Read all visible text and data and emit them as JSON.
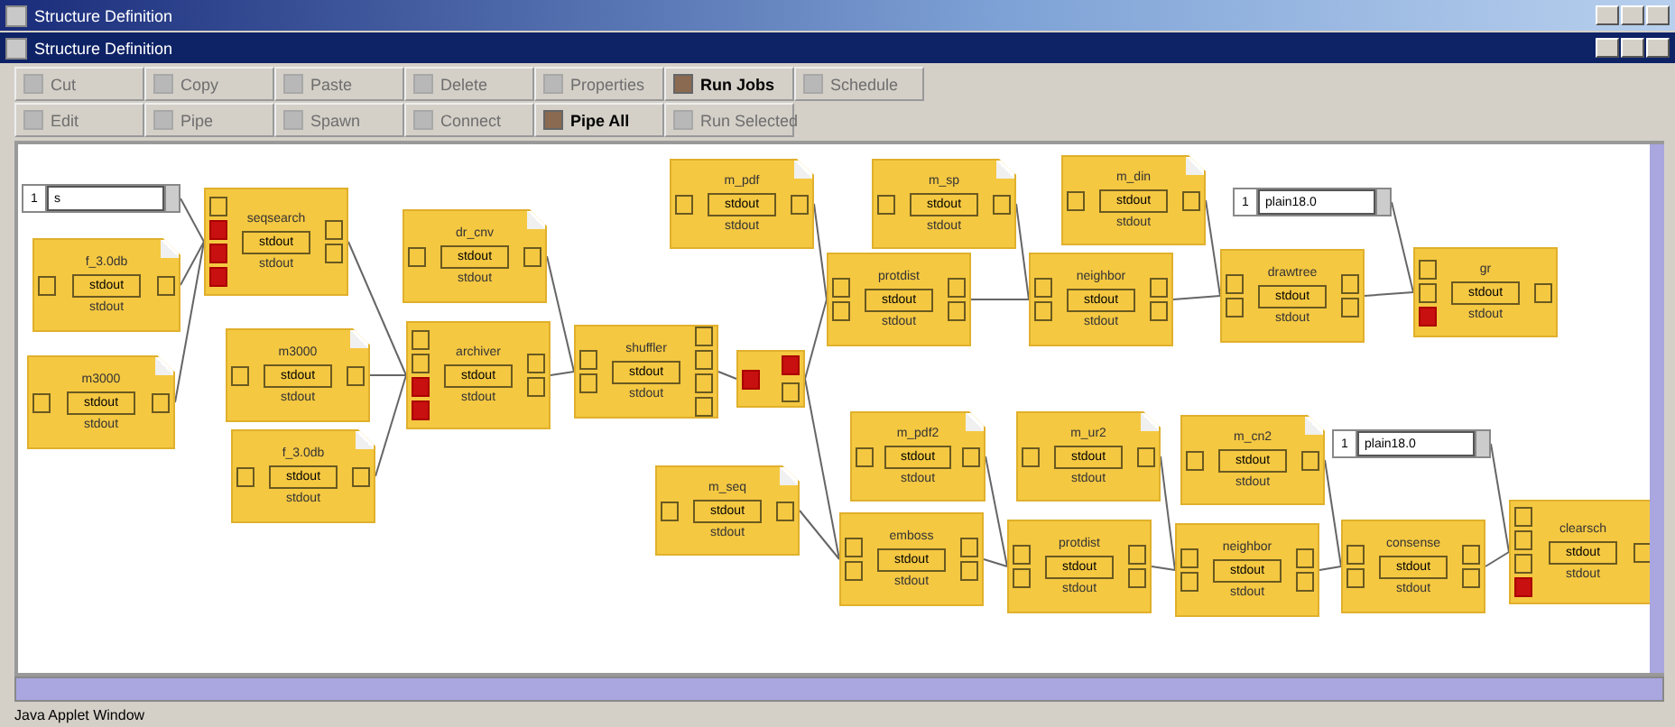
{
  "window": {
    "title": "Structure Definition"
  },
  "inner_window": {
    "title": "Structure Definition"
  },
  "toolbar": [
    [
      {
        "label": "Cut",
        "disabled": true
      },
      {
        "label": "Copy",
        "disabled": true
      },
      {
        "label": "Paste",
        "disabled": true
      },
      {
        "label": "Delete",
        "disabled": true
      },
      {
        "label": "Properties",
        "disabled": true
      },
      {
        "label": "Run Jobs",
        "disabled": false
      },
      {
        "label": "Schedule",
        "disabled": true
      }
    ],
    [
      {
        "label": "Edit",
        "disabled": true
      },
      {
        "label": "Pipe",
        "disabled": true
      },
      {
        "label": "Spawn",
        "disabled": true
      },
      {
        "label": "Connect",
        "disabled": true
      },
      {
        "label": "Pipe All",
        "disabled": false
      },
      {
        "label": "Run Selected",
        "disabled": true
      }
    ]
  ],
  "nodes": [
    {
      "kind": "input",
      "index": "1",
      "value": "s"
    },
    {
      "kind": "document",
      "name": "f_3.0db",
      "label": "stdout",
      "caption": "stdout"
    },
    {
      "kind": "document",
      "name": "m3000",
      "label": "stdout",
      "caption": "stdout"
    },
    {
      "kind": "process",
      "name": "seqsearch",
      "label": "stdout",
      "caption": "stdout",
      "in_ports": [
        {
          "filled": false
        },
        {
          "filled": true
        },
        {
          "filled": true
        },
        {
          "filled": true
        }
      ],
      "out_ports": [
        {
          "filled": false
        },
        {
          "filled": false
        }
      ]
    },
    {
      "kind": "document",
      "name": "dr_cnv",
      "label": "stdout",
      "caption": "stdout"
    },
    {
      "kind": "document",
      "name": "m3000",
      "label": "stdout",
      "caption": "stdout"
    },
    {
      "kind": "document",
      "name": "f_3.0db",
      "label": "stdout",
      "caption": "stdout"
    },
    {
      "kind": "process",
      "name": "archiver",
      "label": "stdout",
      "caption": "stdout",
      "in_ports": [
        {
          "filled": false
        },
        {
          "filled": false
        },
        {
          "filled": true
        },
        {
          "filled": true
        }
      ],
      "out_ports": [
        {
          "filled": false
        },
        {
          "filled": false
        }
      ]
    },
    {
      "kind": "process",
      "name": "shuffler",
      "label": "stdout",
      "caption": "stdout",
      "in_ports": [
        {
          "filled": false
        },
        {
          "filled": false
        }
      ],
      "out_ports": [
        {
          "filled": false
        },
        {
          "filled": false
        },
        {
          "filled": false
        },
        {
          "filled": false
        }
      ]
    },
    {
      "kind": "joiner",
      "in_ports": [
        {
          "filled": true
        }
      ],
      "out_ports": [
        {
          "filled": true
        },
        {
          "filled": false
        }
      ]
    },
    {
      "kind": "document",
      "name": "m_pdf",
      "label": "stdout",
      "caption": "stdout"
    },
    {
      "kind": "document",
      "name": "m_sp",
      "label": "stdout",
      "caption": "stdout"
    },
    {
      "kind": "document",
      "name": "m_din",
      "label": "stdout",
      "caption": "stdout"
    },
    {
      "kind": "input",
      "index": "1",
      "value": "plain18.0"
    },
    {
      "kind": "process",
      "name": "protdist",
      "label": "stdout",
      "caption": "stdout",
      "in_ports": [
        {
          "filled": false
        },
        {
          "filled": false
        }
      ],
      "out_ports": [
        {
          "filled": false
        },
        {
          "filled": false
        }
      ]
    },
    {
      "kind": "process",
      "name": "neighbor",
      "label": "stdout",
      "caption": "stdout",
      "in_ports": [
        {
          "filled": false
        },
        {
          "filled": false
        }
      ],
      "out_ports": [
        {
          "filled": false
        },
        {
          "filled": false
        }
      ]
    },
    {
      "kind": "process",
      "name": "drawtree",
      "label": "stdout",
      "caption": "stdout",
      "in_ports": [
        {
          "filled": false
        },
        {
          "filled": false
        }
      ],
      "out_ports": [
        {
          "filled": false
        },
        {
          "filled": false
        }
      ]
    },
    {
      "kind": "process",
      "name": "gr",
      "label": "stdout",
      "caption": "stdout",
      "in_ports": [
        {
          "filled": false
        },
        {
          "filled": false
        },
        {
          "filled": true
        }
      ],
      "out_ports": [
        {
          "filled": false
        }
      ]
    },
    {
      "kind": "document",
      "name": "m_pdf2",
      "label": "stdout",
      "caption": "stdout"
    },
    {
      "kind": "document",
      "name": "m_ur2",
      "label": "stdout",
      "caption": "stdout"
    },
    {
      "kind": "document",
      "name": "m_cn2",
      "label": "stdout",
      "caption": "stdout"
    },
    {
      "kind": "input",
      "index": "1",
      "value": "plain18.0"
    },
    {
      "kind": "document",
      "name": "m_seq",
      "label": "stdout",
      "caption": "stdout"
    },
    {
      "kind": "process",
      "name": "emboss",
      "label": "stdout",
      "caption": "stdout",
      "in_ports": [
        {
          "filled": false
        },
        {
          "filled": false
        }
      ],
      "out_ports": [
        {
          "filled": false
        },
        {
          "filled": false
        }
      ]
    },
    {
      "kind": "process",
      "name": "protdist",
      "label": "stdout",
      "caption": "stdout",
      "in_ports": [
        {
          "filled": false
        },
        {
          "filled": false
        }
      ],
      "out_ports": [
        {
          "filled": false
        },
        {
          "filled": false
        }
      ]
    },
    {
      "kind": "process",
      "name": "neighbor",
      "label": "stdout",
      "caption": "stdout",
      "in_ports": [
        {
          "filled": false
        },
        {
          "filled": false
        }
      ],
      "out_ports": [
        {
          "filled": false
        },
        {
          "filled": false
        }
      ]
    },
    {
      "kind": "process",
      "name": "consense",
      "label": "stdout",
      "caption": "stdout",
      "in_ports": [
        {
          "filled": false
        },
        {
          "filled": false
        }
      ],
      "out_ports": [
        {
          "filled": false
        },
        {
          "filled": false
        }
      ]
    },
    {
      "kind": "process",
      "name": "clearsch",
      "label": "stdout",
      "caption": "stdout",
      "in_ports": [
        {
          "filled": false
        },
        {
          "filled": false
        },
        {
          "filled": false
        },
        {
          "filled": true
        }
      ],
      "out_ports": [
        {
          "filled": false
        }
      ]
    }
  ],
  "status_bar": {
    "text": "Java Applet Window"
  }
}
